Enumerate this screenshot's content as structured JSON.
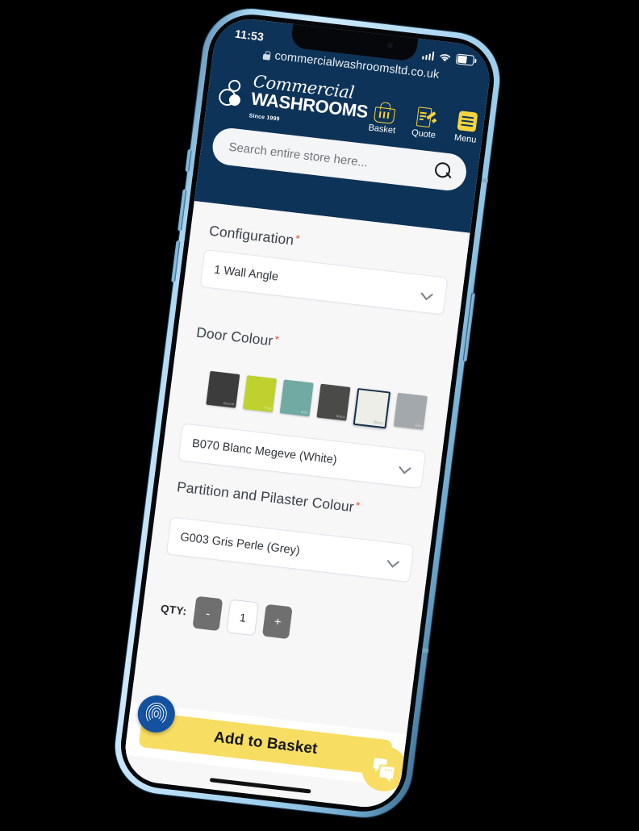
{
  "status_bar": {
    "time": "11:53",
    "signal_icon": "signal-bars-icon",
    "wifi_icon": "wifi-icon",
    "battery_icon": "battery-icon"
  },
  "browser": {
    "lock_icon": "lock-icon",
    "url": "commercialwashroomsltd.co.uk"
  },
  "header": {
    "logo": {
      "line1": "Commercial",
      "line2": "WASHROOMS",
      "tagline": "Since 1999"
    },
    "nav": [
      {
        "label": "Basket",
        "icon": "basket-icon"
      },
      {
        "label": "Quote",
        "icon": "quote-icon"
      },
      {
        "label": "Menu",
        "icon": "menu-icon"
      }
    ]
  },
  "search": {
    "placeholder": "Search entire store here...",
    "icon": "search-icon"
  },
  "form": {
    "configuration": {
      "label": "Configuration",
      "required_marker": "*",
      "value": "1 Wall Angle"
    },
    "door_colour": {
      "label": "Door Colour",
      "required_marker": "*",
      "value": "B070 Blanc Megeve (White)",
      "swatches": [
        {
          "name": "Basalt",
          "hex": "#3c3c3c",
          "selected": false
        },
        {
          "name": "Pop",
          "hex": "#bed12f",
          "selected": false
        },
        {
          "name": "Mint",
          "hex": "#71a9a3",
          "selected": false
        },
        {
          "name": "Marq",
          "hex": "#4a4a48",
          "selected": false
        },
        {
          "name": "Blanc",
          "hex": "#eceee7",
          "selected": true
        },
        {
          "name": "Gris",
          "hex": "#a3a8ac",
          "selected": false
        }
      ]
    },
    "partition_colour": {
      "label": "Partition and Pilaster Colour",
      "required_marker": "*",
      "value": "G003 Gris Perle (Grey)"
    },
    "quantity": {
      "label": "QTY:",
      "decrement": "-",
      "value": "1",
      "increment": "+"
    }
  },
  "actions": {
    "add_to_basket": "Add to Basket",
    "biometric_icon": "fingerprint-icon",
    "chat_icon": "chat-bubble-icon"
  },
  "colors": {
    "brand_navy": "#0e3358",
    "brand_yellow": "#f5d33f",
    "button_yellow": "#f7dd62",
    "required_red": "#e8462f",
    "device_frame": "#a9d6f0"
  }
}
